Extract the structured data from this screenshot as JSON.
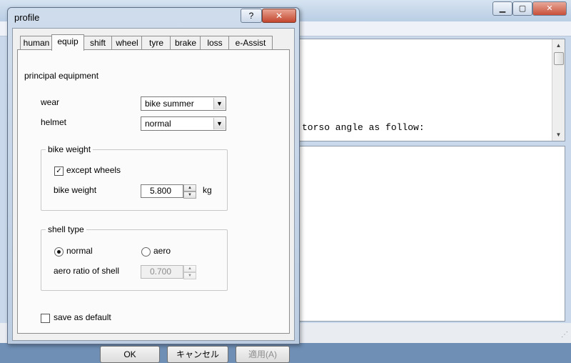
{
  "dialog": {
    "title": "profile",
    "help_label": "?",
    "close_label": "✕",
    "tabs": [
      "human",
      "equip",
      "shift",
      "wheel",
      "tyre",
      "brake",
      "loss",
      "e-Assist"
    ],
    "active_tab": "equip",
    "section_title": "principal equipment",
    "wear": {
      "label": "wear",
      "value": "bike summer"
    },
    "helmet": {
      "label": "helmet",
      "value": "normal"
    },
    "bike_weight_group": {
      "legend": "bike weight",
      "except_wheels": {
        "label": "except wheels",
        "checked": true
      },
      "bike_weight": {
        "label": "bike weight",
        "value": "5.800",
        "unit": "kg"
      }
    },
    "shell_type_group": {
      "legend": "shell type",
      "normal": {
        "label": "normal",
        "selected": true
      },
      "aero": {
        "label": "aero",
        "selected": false
      },
      "aero_ratio": {
        "label": "aero ratio of shell",
        "value": "0.700",
        "enabled": false
      }
    },
    "save_default": {
      "label": "save as default",
      "checked": false
    },
    "buttons": {
      "ok": "OK",
      "cancel": "キャンセル",
      "apply": "適用(A)"
    }
  },
  "main_window": {
    "minimize": "▁",
    "maximize": "▢",
    "close": "✕",
    "output_text": "torso angle as follow:"
  },
  "colors": {
    "dialog_frame": "#c4d4e8",
    "close_button": "#c4462e",
    "tab_panel": "#fbfbfb"
  }
}
